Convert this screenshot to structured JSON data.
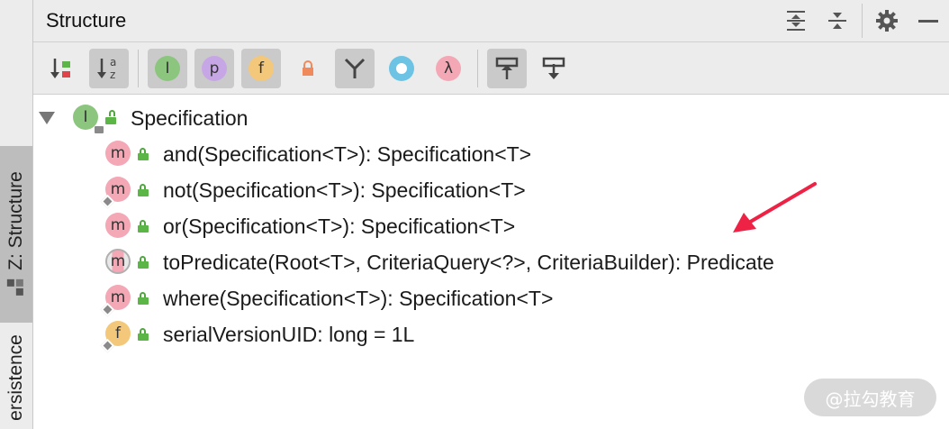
{
  "panel": {
    "title": "Structure"
  },
  "left_strip": {
    "tab_active": "Z: Structure",
    "tab_second": "Persistence",
    "tab_second_visible": "ersistence"
  },
  "toolbar": {
    "buttons": [
      {
        "icon": "sort-by-visibility-icon",
        "active": false
      },
      {
        "icon": "sort-alphabetically-icon",
        "active": true,
        "glyph": "↓a z"
      },
      {
        "icon": "show-inherited-icon",
        "active": true,
        "glyph": "I"
      },
      {
        "icon": "show-properties-icon",
        "active": true,
        "glyph": "p"
      },
      {
        "icon": "show-fields-icon",
        "active": true,
        "glyph": "f"
      },
      {
        "icon": "show-non-public-icon",
        "active": false
      },
      {
        "icon": "group-methods-icon",
        "active": true
      },
      {
        "icon": "show-anonymous-icon",
        "active": false
      },
      {
        "icon": "show-lambdas-icon",
        "active": false,
        "glyph": "λ"
      },
      {
        "icon": "autoscroll-to-source-icon",
        "active": true
      },
      {
        "icon": "autoscroll-from-source-icon",
        "active": false
      }
    ]
  },
  "tree": {
    "root": {
      "label": "Specification",
      "kind_glyph": "I"
    },
    "members": [
      {
        "label": "and(Specification<T>): Specification<T>",
        "glyph": "m",
        "kind": "method",
        "static": false
      },
      {
        "label": "not(Specification<T>): Specification<T>",
        "glyph": "m",
        "kind": "method",
        "static": true
      },
      {
        "label": "or(Specification<T>): Specification<T>",
        "glyph": "m",
        "kind": "method",
        "static": false
      },
      {
        "label": "toPredicate(Root<T>, CriteriaQuery<?>, CriteriaBuilder): Predicate",
        "glyph": "m",
        "kind": "abstract-method",
        "static": false
      },
      {
        "label": "where(Specification<T>): Specification<T>",
        "glyph": "m",
        "kind": "method",
        "static": true
      },
      {
        "label": "serialVersionUID: long = 1L",
        "glyph": "f",
        "kind": "field",
        "static": true
      }
    ]
  },
  "watermark": {
    "text": "@拉勾教育"
  },
  "colors": {
    "method": "#f4a7b4",
    "field": "#f3c87a",
    "interface": "#8cc57e",
    "property": "#c7a6e6",
    "anonymous": "#6dc3e3",
    "lock": "#5cb547",
    "annotation_arrow": "#ee2244"
  }
}
